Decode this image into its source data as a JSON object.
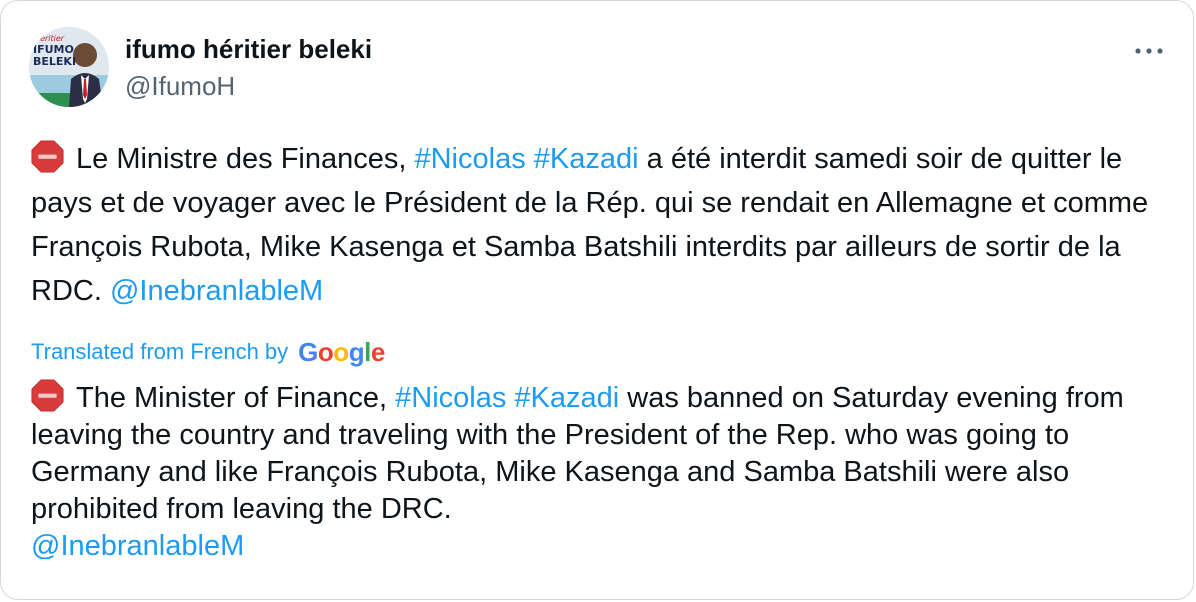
{
  "author": {
    "display_name": "ifumo héritier beleki",
    "handle": "@IfumoH",
    "avatar_text": [
      "héritier",
      "IFUMO",
      "BELEKI"
    ]
  },
  "more_label": "•••",
  "original": {
    "emoji": "stop-sign-icon",
    "text_1": "Le Ministre des Finances, ",
    "hashtag_1": "#Nicolas",
    "hashtag_2": "#Kazadi",
    "text_2": " a été interdit samedi soir de quitter le pays et de voyager avec le Président de la Rép. qui se rendait en Allemagne et comme François Rubota, Mike Kasenga et Samba Batshili interdits par ailleurs de sortir de la RDC. ",
    "mention": "@InebranlableM"
  },
  "translated_label": "Translated from French by",
  "google_label": "Google",
  "translation": {
    "emoji": "stop-sign-icon",
    "text_1": "The Minister of Finance, ",
    "hashtag_1": "#Nicolas",
    "hashtag_2": "#Kazadi",
    "text_2": " was banned on Saturday evening from leaving the country and traveling with the President of the Rep. who was going to Germany and like François Rubota, Mike Kasenga and Samba Batshili were also prohibited from leaving the DRC.",
    "mention": "@InebranlableM"
  },
  "colors": {
    "link": "#1d9bf0",
    "text": "#0f1419",
    "secondary": "#536471",
    "stop_sign": "#d93a3a"
  }
}
